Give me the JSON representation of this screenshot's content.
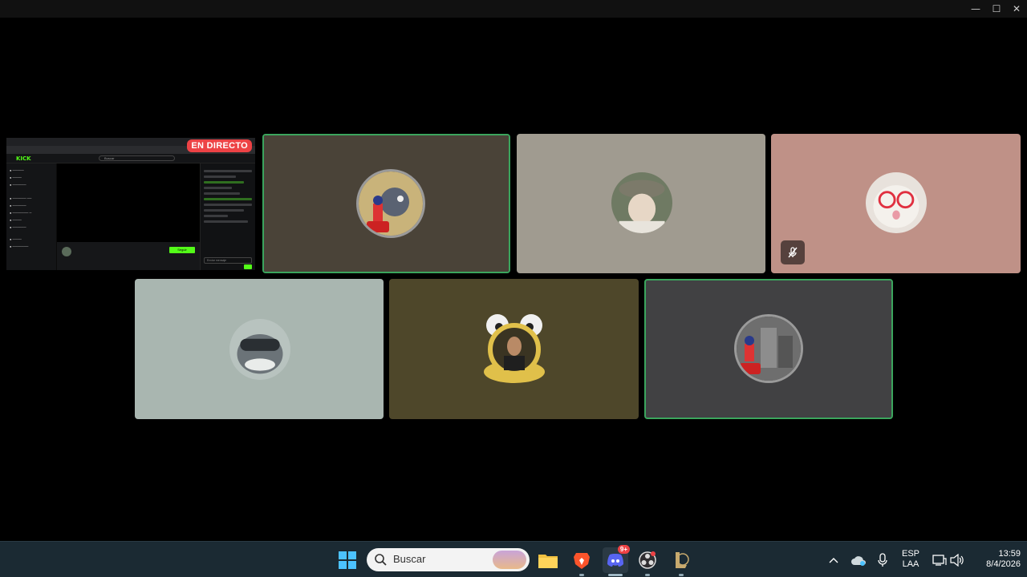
{
  "window": {
    "minimize_glyph": "—",
    "maximize_glyph": "☐",
    "close_glyph": "✕"
  },
  "stream": {
    "live_label": "EN DIRECTO",
    "site_logo": "KICK",
    "search_placeholder": "Buscar",
    "follow_label": "Seguir",
    "chat_placeholder": "Enviar mensaje"
  },
  "taskbar": {
    "search_placeholder": "Buscar",
    "discord_badge": "9+",
    "language_top": "ESP",
    "language_bottom": "LAA",
    "time": "13:59",
    "date": "8/4/2026"
  },
  "tiles": [
    {
      "bg": "#4a4338",
      "speaking": true,
      "icon": "cat-mouse-avatar"
    },
    {
      "bg": "#a09b90",
      "speaking": false,
      "icon": "person-hat-avatar"
    },
    {
      "bg": "#bf9187",
      "speaking": false,
      "muted": true,
      "icon": "cat-glasses-avatar"
    },
    {
      "bg": "#a9b6b0",
      "speaking": false,
      "icon": "shark-avatar"
    },
    {
      "bg": "#4e472a",
      "speaking": false,
      "icon": "frog-frame-avatar"
    },
    {
      "bg": "#414143",
      "speaking": true,
      "icon": "city-avatar"
    }
  ],
  "colors": {
    "speaking_border": "#3ba55d",
    "live_red": "#ed4245",
    "kick_green": "#53fc18"
  }
}
